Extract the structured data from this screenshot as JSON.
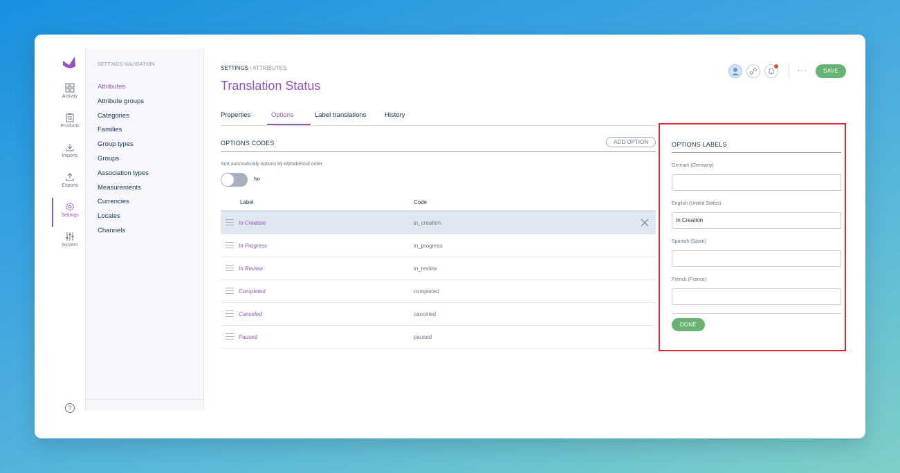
{
  "mainnav": {
    "items": [
      {
        "label": "Activity",
        "icon": "dashboard-icon"
      },
      {
        "label": "Products",
        "icon": "clipboard-icon"
      },
      {
        "label": "Imports",
        "icon": "import-icon"
      },
      {
        "label": "Exports",
        "icon": "export-icon"
      },
      {
        "label": "Settings",
        "icon": "gear-icon"
      },
      {
        "label": "System",
        "icon": "sliders-icon"
      }
    ],
    "active": "Settings",
    "help_glyph": "?"
  },
  "subnav": {
    "title": "SETTINGS NAVIGATION",
    "items": [
      "Attributes",
      "Attribute groups",
      "Categories",
      "Families",
      "Group types",
      "Groups",
      "Association types",
      "Measurements",
      "Currencies",
      "Locales",
      "Channels"
    ]
  },
  "header": {
    "breadcrumb_root": "SETTINGS",
    "breadcrumb_sep": "/",
    "breadcrumb_current": "ATTRIBUTES",
    "title": "Translation Status",
    "more": "···",
    "save_label": "SAVE"
  },
  "tabs": [
    "Properties",
    "Options",
    "Label translations",
    "History"
  ],
  "options_codes": {
    "title": "OPTIONS CODES",
    "add_button": "ADD OPTION",
    "sort_label": "Sort automatically options by alphabetical order",
    "toggle_value": "No",
    "col_label": "Label",
    "col_code": "Code",
    "rows": [
      {
        "label": "In Creation",
        "code": "in_creation"
      },
      {
        "label": "In Progress",
        "code": "in_progress"
      },
      {
        "label": "In Review",
        "code": "in_review"
      },
      {
        "label": "Completed",
        "code": "completed"
      },
      {
        "label": "Canceled",
        "code": "canceled"
      },
      {
        "label": "Paused",
        "code": "paused"
      }
    ]
  },
  "options_labels": {
    "title": "OPTIONS LABELS",
    "fields": [
      {
        "label": "German (Germany)",
        "value": ""
      },
      {
        "label": "English (United States)",
        "value": "In Creation"
      },
      {
        "label": "Spanish (Spain)",
        "value": ""
      },
      {
        "label": "French (France)",
        "value": ""
      }
    ],
    "done_label": "DONE"
  },
  "colors": {
    "accent": "#9452ba",
    "success": "#67b373",
    "highlight_border": "#e0232e"
  }
}
